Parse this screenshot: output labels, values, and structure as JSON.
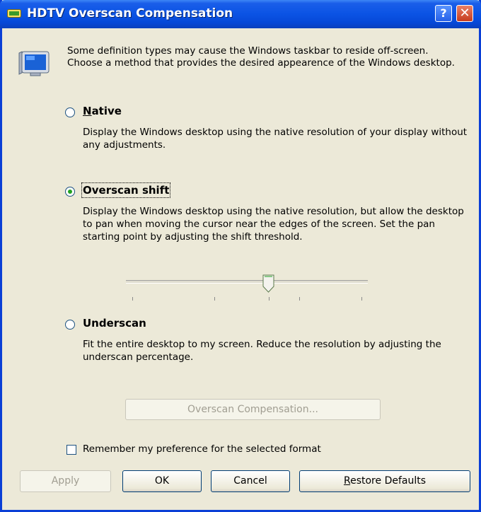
{
  "window": {
    "title": "HDTV Overscan Compensation",
    "help_glyph": "?",
    "close_glyph": "✕"
  },
  "intro": "Some definition types may cause the Windows taskbar to reside off-screen. Choose a method that provides the desired appearence of the Windows desktop.",
  "options": [
    {
      "label": "Native",
      "selected": false,
      "description": "Display the Windows desktop using the native resolution of your display without any adjustments."
    },
    {
      "label": "Overscan shift",
      "selected": true,
      "description": "Display the Windows desktop using the native resolution, but allow the desktop to pan when moving the cursor near the edges of the screen. Set the pan starting point by adjusting the shift threshold."
    },
    {
      "label": "Underscan",
      "selected": false,
      "description": "Fit the entire desktop to my screen. Reduce the resolution by adjusting the underscan percentage."
    }
  ],
  "slider": {
    "ticks": 5,
    "position": 2
  },
  "overscan_button": "Overscan Compensation...",
  "remember_checkbox": {
    "label": "Remember my preference for the selected format",
    "checked": false
  },
  "buttons": {
    "apply": "Apply",
    "ok": "OK",
    "cancel": "Cancel",
    "restore": "Restore Defaults"
  },
  "colors": {
    "titlebar": "#0b53e4",
    "dialog_bg": "#ece9d8",
    "radio_dot": "#21a121"
  }
}
